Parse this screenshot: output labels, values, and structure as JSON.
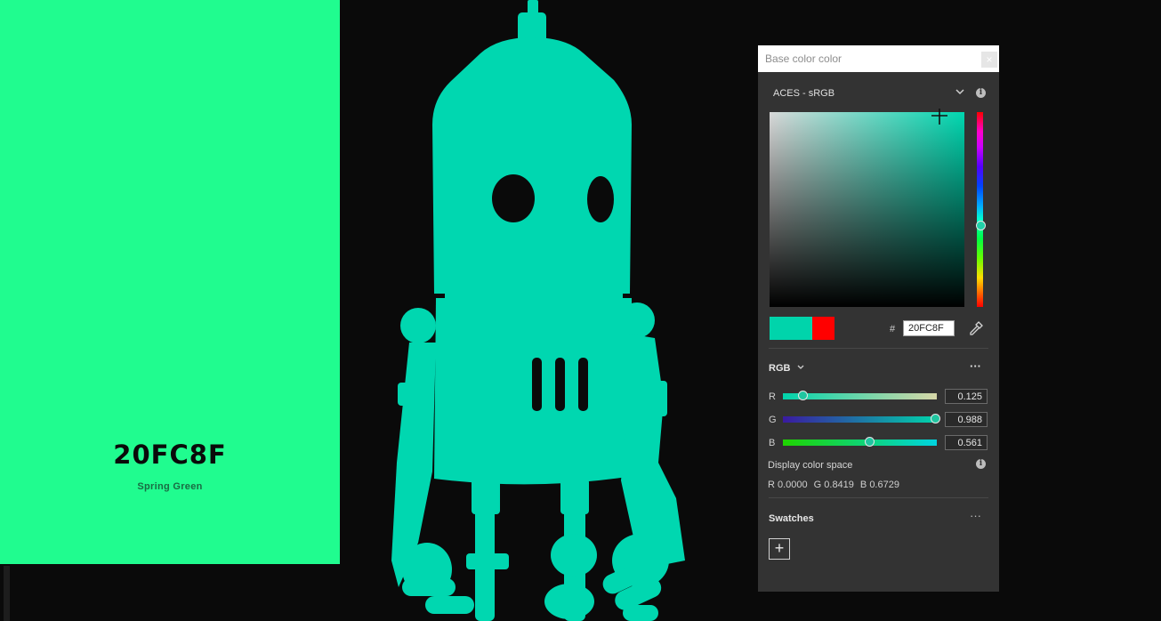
{
  "swatch_card": {
    "hex": "20FC8F",
    "name": "Spring Green",
    "color": "#20fc8f"
  },
  "viewport": {
    "robot_color": "#00d7b0"
  },
  "panel": {
    "title": "Base color color",
    "close_icon": "close-icon",
    "color_space": "ACES - sRGB",
    "hex_prefix": "#",
    "hex_value": "20FC8F",
    "preview_new_color": "#00d4ab",
    "preview_old_color": "#ff0000",
    "mode": "RGB",
    "more_label": "···",
    "channels": [
      {
        "label": "R",
        "value": "0.125",
        "fraction": 0.125
      },
      {
        "label": "G",
        "value": "0.988",
        "fraction": 0.988
      },
      {
        "label": "B",
        "value": "0.561",
        "fraction": 0.561
      }
    ],
    "display_color_space": {
      "label": "Display color space",
      "r": "R 0.0000",
      "g": "G 0.8419",
      "b": "B 0.6729"
    },
    "swatches": {
      "label": "Swatches",
      "add_label": "+"
    }
  }
}
